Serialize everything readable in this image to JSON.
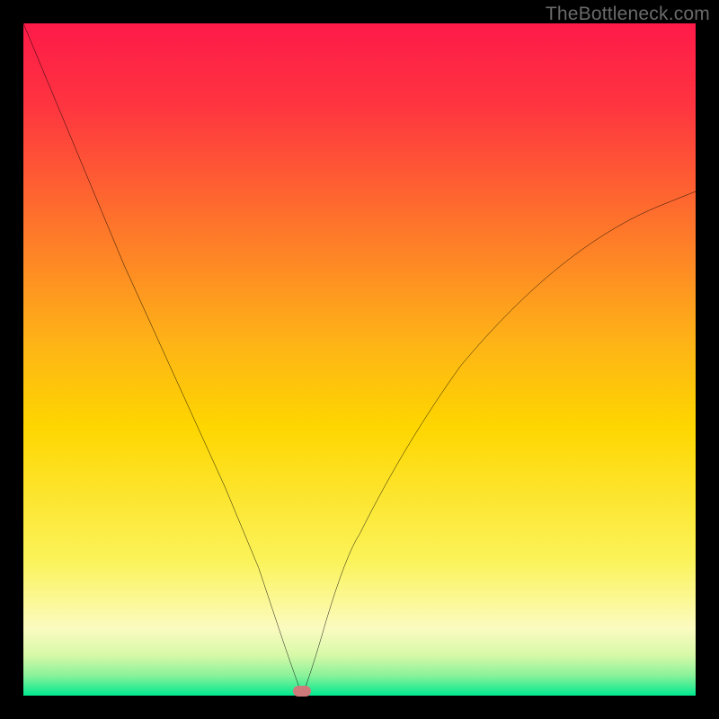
{
  "attribution": "TheBottleneck.com",
  "colors": {
    "top": "#fe1a49",
    "mid": "#fed600",
    "low_pale": "#fdfcb4",
    "green": "#00e990",
    "curve": "#000000",
    "marker": "#cf7a7a",
    "border": "#000000"
  },
  "chart_data": {
    "type": "line",
    "title": "",
    "xlabel": "",
    "ylabel": "",
    "xlim": [
      0,
      100
    ],
    "ylim": [
      0,
      100
    ],
    "x": [
      0,
      5,
      10,
      15,
      20,
      25,
      30,
      35,
      38,
      40,
      41.5,
      43,
      45,
      50,
      55,
      60,
      65,
      70,
      75,
      80,
      85,
      90,
      95,
      100
    ],
    "y": [
      100,
      88,
      76,
      64,
      53,
      42,
      31,
      19,
      10,
      4,
      0,
      4,
      11,
      24,
      34,
      42,
      49,
      55,
      60,
      64,
      68,
      71,
      73,
      75
    ],
    "minimum": {
      "x": 41.5,
      "y": 0
    },
    "annotations": []
  }
}
